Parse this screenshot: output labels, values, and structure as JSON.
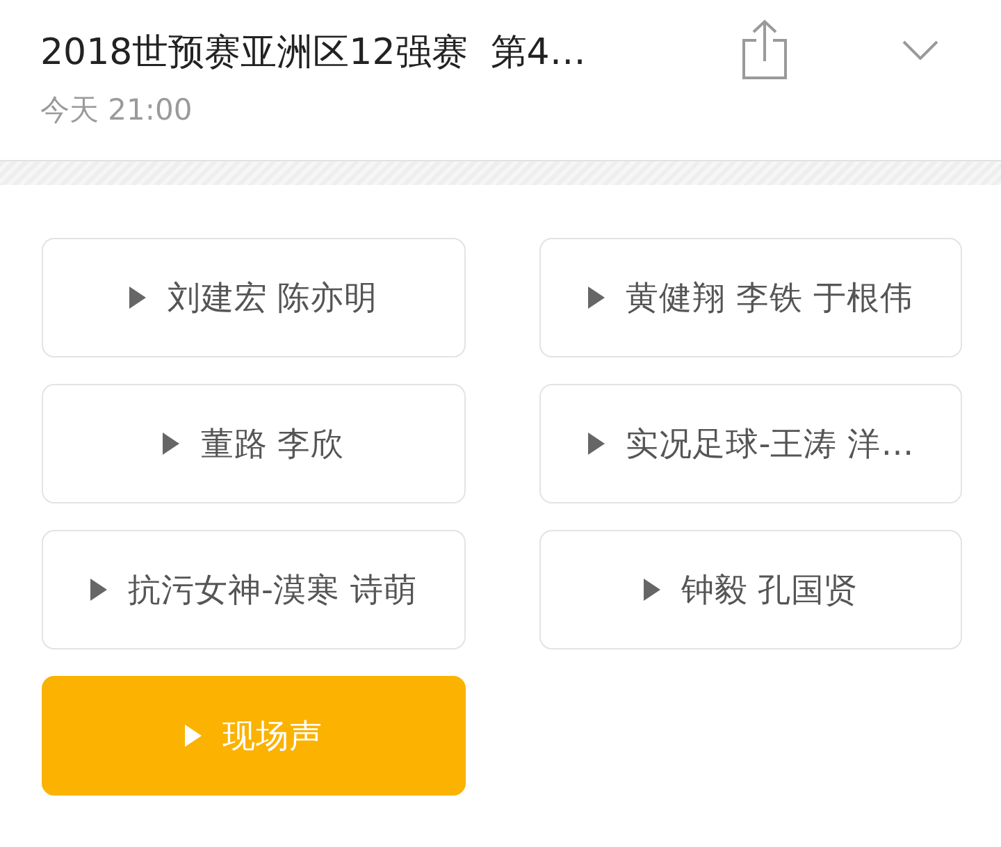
{
  "header": {
    "title": "2018世预赛亚洲区12强赛  第4…",
    "time": "今天 21:00"
  },
  "channels": [
    {
      "label": "刘建宏 陈亦明",
      "selected": false
    },
    {
      "label": "黄健翔 李铁 于根伟",
      "selected": false
    },
    {
      "label": "董路 李欣",
      "selected": false
    },
    {
      "label": "实况足球-王涛 洋…",
      "selected": false
    },
    {
      "label": "抗污女神-漠寒 诗萌",
      "selected": false
    },
    {
      "label": "钟毅 孔国贤",
      "selected": false
    },
    {
      "label": "现场声",
      "selected": true
    }
  ]
}
